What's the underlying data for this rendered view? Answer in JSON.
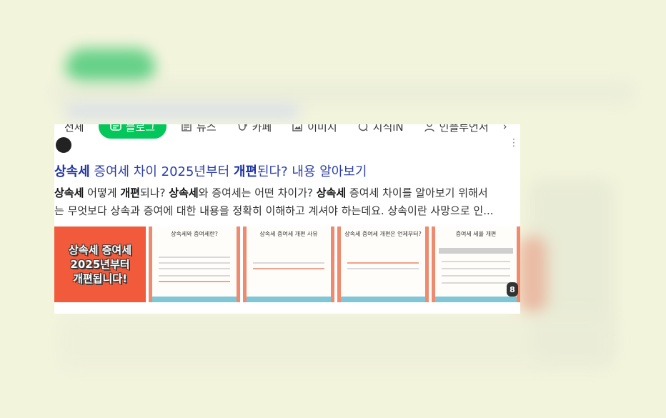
{
  "tabs": [
    {
      "label": "전체",
      "icon": "search-icon",
      "active": false
    },
    {
      "label": "블로그",
      "icon": "blog-icon",
      "active": true
    },
    {
      "label": "뉴스",
      "icon": "news-icon",
      "active": false
    },
    {
      "label": "카페",
      "icon": "cafe-icon",
      "active": false
    },
    {
      "label": "이미지",
      "icon": "image-icon",
      "active": false
    },
    {
      "label": "지식iN",
      "icon": "knowledge-icon",
      "active": false
    },
    {
      "label": "인플루언서",
      "icon": "person-icon",
      "active": false
    }
  ],
  "result": {
    "title_parts": [
      "상속세",
      " 증여세 차이 2025년부터 ",
      "개편",
      "된다? 내용 알아보기"
    ],
    "desc_parts": [
      "상속세",
      " 어떻게 ",
      "개편",
      "되나? ",
      "상속세",
      "와 증여세는 어떤 차이가? ",
      "상속세",
      " 증여세 차이를 알아보기 위해서"
    ],
    "desc_line2": "는 무엇보다 상속과 증여에 대한 내용을 정확히 이해하고 계셔야 하는데요. 상속이란 사망으로 인...",
    "thumb_main_text": "상속세 증여세\n2025년부터\n개편됩니다!",
    "slides": [
      "상속세와 증여세란?",
      "상속세 증여세 개편 사유",
      "상속세 증여세 개편은 언제부터?",
      "증여세 세율 개편"
    ],
    "image_count": "8"
  },
  "colors": {
    "accent": "#03c75a",
    "title": "#2c3fa8",
    "thumb_red": "#f15a3a"
  }
}
